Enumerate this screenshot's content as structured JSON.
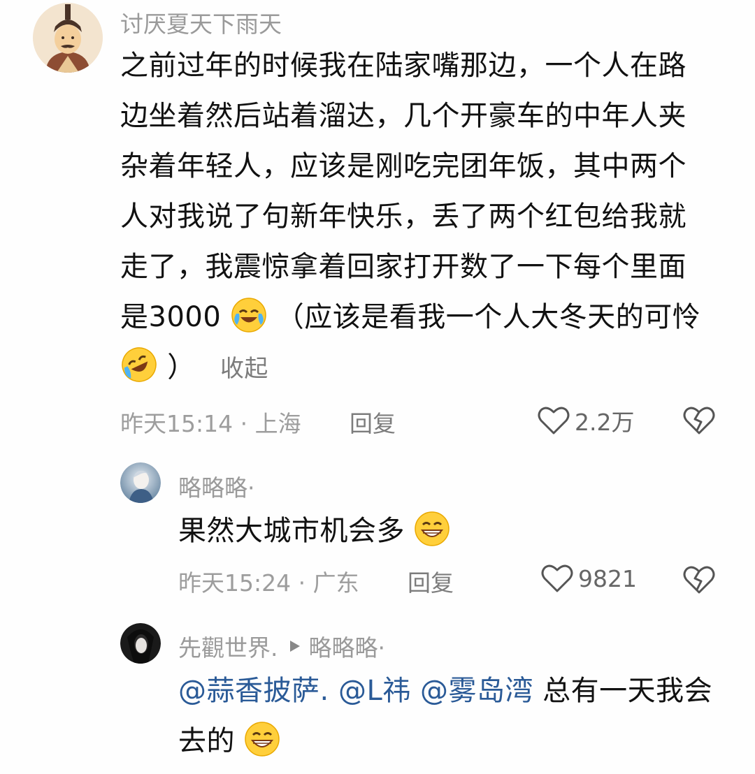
{
  "comments": [
    {
      "author": "讨厌夏天下雨天",
      "lines": [
        "之前过年的时候我在陆家嘴那边，一个人在路",
        "边坐着然后站着溜达，几个开豪车的中年人夹",
        "杂着年轻人，应该是刚吃完团年饭，其中两个",
        "人对我说了句新年快乐，丢了两个红包给我就",
        "走了，我震惊拿着回家打开数了一下每个里面"
      ],
      "line6_a": "是3000",
      "line6_b": "（应该是看我一个人大冬天的可怜",
      "line7_b": "）",
      "collapse": "收起",
      "meta": "昨天15:14 · 上海",
      "reply": "回复",
      "likes": "2.2万"
    },
    {
      "author": "略略略·",
      "text": "果然大城市机会多",
      "meta": "昨天15:24 · 广东",
      "reply": "回复",
      "likes": "9821"
    },
    {
      "author": "先觀世界.",
      "reply_to": "略略略·",
      "mentions": [
        "@蒜香披萨.",
        "@L祎",
        "@雾岛湾"
      ],
      "text_tail": "总有一天我会",
      "text_line2": "去的"
    }
  ],
  "icons": {
    "like": "heart-outline-icon",
    "dislike": "broken-heart-icon",
    "reply_arrow": "play-triangle-icon",
    "emoji_cry_laugh": "crying-laughing-emoji",
    "emoji_rofl": "rolling-laughing-emoji",
    "emoji_grin": "grinning-squint-emoji"
  },
  "colors": {
    "link": "#2a5a97",
    "meta": "#9d9d9d",
    "name": "#9a9a9a"
  }
}
